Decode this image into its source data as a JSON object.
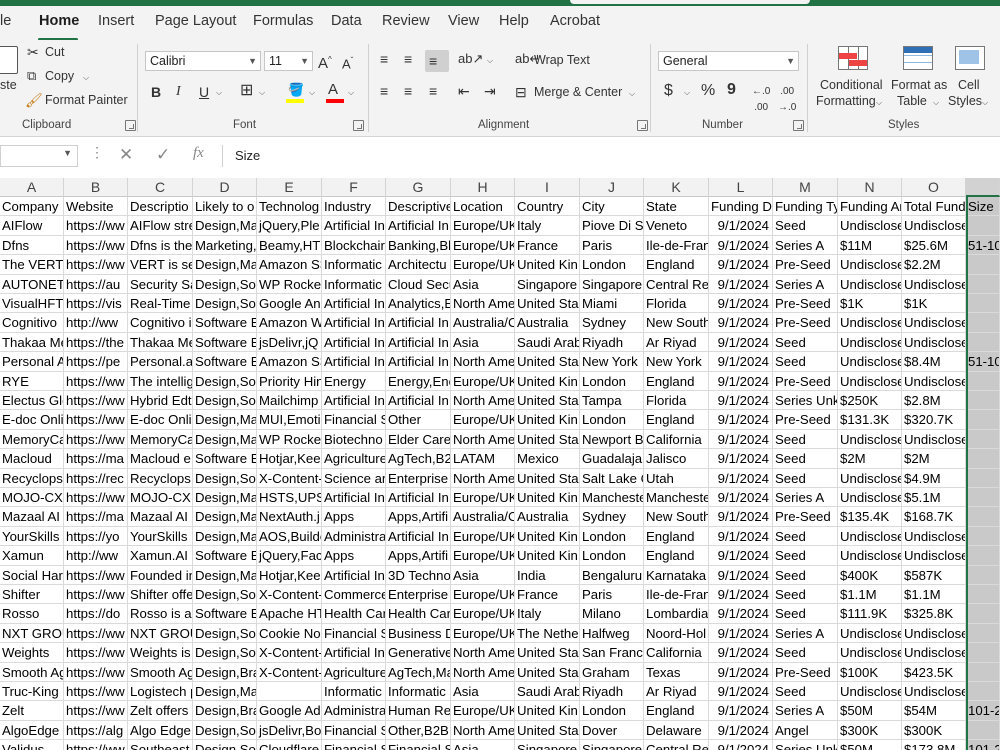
{
  "ribbon_tabs": [
    "le",
    "Home",
    "Insert",
    "Page Layout",
    "Formulas",
    "Data",
    "Review",
    "View",
    "Help",
    "Acrobat"
  ],
  "clipboard": {
    "paste": "ste",
    "cut": "Cut",
    "copy": "Copy",
    "format_painter": "Format Painter",
    "group": "Clipboard"
  },
  "font": {
    "name": "Calibri",
    "size": "11",
    "group": "Font"
  },
  "alignment": {
    "wrap_text": "Wrap Text",
    "merge_center": "Merge & Center",
    "group": "Alignment"
  },
  "number": {
    "format": "General",
    "group": "Number",
    "currency_symbol": "$",
    "percent_symbol": "%",
    "comma_symbol": "9"
  },
  "styles": {
    "conditional_formatting": [
      "Conditional",
      "Formatting"
    ],
    "format_as_table": [
      "Format as",
      "Table"
    ],
    "cell_styles": [
      "Cell",
      "Styles"
    ],
    "group": "Styles"
  },
  "formula_bar": {
    "fx": "fx",
    "value": "Size"
  },
  "columns": [
    "A",
    "B",
    "C",
    "D",
    "E",
    "F",
    "G",
    "H",
    "I",
    "J",
    "K",
    "L",
    "M",
    "N",
    "O"
  ],
  "selected_column_header": "",
  "rows": [
    [
      "Company",
      "Website",
      "Descriptio",
      "Likely to o",
      "Technolog",
      "Industry",
      "Descriptive",
      "Location",
      "Country",
      "City",
      "State",
      "Funding Da",
      "Funding Ty",
      "Funding Ar",
      "Total Fund",
      "Size"
    ],
    [
      "AIFlow",
      "https://ww",
      "AIFlow stre",
      "Design,Ma",
      "jQuery,Ple",
      "Artificial In",
      "Artificial In",
      "Europe/UK",
      "Italy",
      "Piove Di Sa",
      "Veneto",
      "9/1/2024",
      "Seed",
      "Undisclose",
      "Undisclose",
      ""
    ],
    [
      "Dfns",
      "https://ww",
      "Dfns is the",
      "Marketing,",
      "Beamy,HT",
      "Blockchair",
      "Banking,Bl",
      "Europe/UK",
      "France",
      "Paris",
      "Ile-de-Fran",
      "9/1/2024",
      "Series A",
      "$11M",
      "$25.6M",
      "51-10"
    ],
    [
      "The VERT",
      "https://ww",
      "VERT is set",
      "Design,Ma",
      "Amazon S3",
      "Informatic",
      "Architectu",
      "Europe/UK",
      "United Kin",
      "London",
      "England",
      "9/1/2024",
      "Pre-Seed",
      "Undisclose",
      "$2.2M",
      ""
    ],
    [
      "AUTONETI",
      "https://au",
      "Security Sa",
      "Design,Sof",
      "WP Rocket",
      "Informatic",
      "Cloud Secu",
      "Asia",
      "Singapore",
      "Singapore",
      "Central Re",
      "9/1/2024",
      "Series A",
      "Undisclose",
      "Undisclose",
      ""
    ],
    [
      "VisualHFT",
      "https://vis",
      "Real-Time",
      "Design,Sof",
      "Google An",
      "Artificial In",
      "Analytics,E",
      "North Ame",
      "United Sta",
      "Miami",
      "Florida",
      "9/1/2024",
      "Pre-Seed",
      "$1K",
      "$1K",
      ""
    ],
    [
      "Cognitivo",
      "http://ww",
      "Cognitivo i",
      "Software E",
      "Amazon W",
      "Artificial In",
      "Artificial In",
      "Australia/C",
      "Australia",
      "Sydney",
      "New South",
      "9/1/2024",
      "Pre-Seed",
      "Undisclose",
      "Undisclose",
      ""
    ],
    [
      "Thakaa Me",
      "https://the",
      "Thakaa Me",
      "Software E",
      "jsDelivr,jQ",
      "Artificial In",
      "Artificial In",
      "Asia",
      "Saudi Arab",
      "Riyadh",
      "Ar Riyad",
      "9/1/2024",
      "Seed",
      "Undisclose",
      "Undisclose",
      ""
    ],
    [
      "Personal A",
      "https://pe",
      "Personal.a",
      "Software E",
      "Amazon S3",
      "Artificial In",
      "Artificial In",
      "North Ame",
      "United Sta",
      "New York",
      "New York",
      "9/1/2024",
      "Seed",
      "Undisclose",
      "$8.4M",
      "51-10"
    ],
    [
      "RYE",
      "https://ww",
      "The intellig",
      "Design,Sof",
      "Priority Hin",
      "Energy",
      "Energy,Ene",
      "Europe/UK",
      "United Kin",
      "London",
      "England",
      "9/1/2024",
      "Pre-Seed",
      "Undisclose",
      "Undisclose",
      ""
    ],
    [
      "Electus Glo",
      "https://ww",
      "Hybrid Edt",
      "Design,Sof",
      "Mailchimp",
      "Artificial In",
      "Artificial In",
      "North Ame",
      "United Sta",
      "Tampa",
      "Florida",
      "9/1/2024",
      "Series Unk",
      "$250K",
      "$2.8M",
      ""
    ],
    [
      "E-doc Onli",
      "https://ww",
      "E-doc Onli",
      "Design,Ma",
      "MUI,Emoti",
      "Financial S",
      "Other",
      "Europe/UK",
      "United Kin",
      "London",
      "England",
      "9/1/2024",
      "Pre-Seed",
      "$131.3K",
      "$320.7K",
      ""
    ],
    [
      "MemoryCa",
      "https://ww",
      "MemoryCa",
      "Design,Ma",
      "WP Rocket",
      "Biotechno",
      "Elder Care",
      "North Ame",
      "United Sta",
      "Newport B",
      "California",
      "9/1/2024",
      "Seed",
      "Undisclose",
      "Undisclose",
      ""
    ],
    [
      "Macloud",
      "https://ma",
      "Macloud e",
      "Software E",
      "Hotjar,Kee",
      "Agriculture",
      "AgTech,B2",
      "LATAM",
      "Mexico",
      "Guadalajar",
      "Jalisco",
      "9/1/2024",
      "Seed",
      "$2M",
      "$2M",
      ""
    ],
    [
      "Recyclops",
      "https://rec",
      "Recyclops",
      "Design,Sof",
      "X-Content-",
      "Science an",
      "Enterprise",
      "North Ame",
      "United Sta",
      "Salt Lake C",
      "Utah",
      "9/1/2024",
      "Seed",
      "Undisclose",
      "$4.9M",
      ""
    ],
    [
      "MOJO-CX",
      "https://ww",
      "MOJO-CX i",
      "Design,Ma",
      "HSTS,UPS,I",
      "Artificial In",
      "Artificial In",
      "Europe/UK",
      "United Kin",
      "Mancheste",
      "Mancheste",
      "9/1/2024",
      "Series A",
      "Undisclose",
      "$5.1M",
      ""
    ],
    [
      "Mazaal AI",
      "https://ma",
      "Mazaal AI",
      "Design,Ma",
      "NextAuth.j",
      "Apps",
      "Apps,Artifi",
      "Australia/C",
      "Australia",
      "Sydney",
      "New South",
      "9/1/2024",
      "Pre-Seed",
      "$135.4K",
      "$168.7K",
      ""
    ],
    [
      "YourSkills",
      "https://yo",
      "YourSkills i",
      "Design,Ma",
      "AOS,Builde",
      "Administra",
      "Artificial In",
      "Europe/UK",
      "United Kin",
      "London",
      "England",
      "9/1/2024",
      "Seed",
      "Undisclose",
      "Undisclose",
      ""
    ],
    [
      "Xamun",
      "http://ww",
      "Xamun.AI",
      "Software E",
      "jQuery,Fac",
      "Apps",
      "Apps,Artifi",
      "Europe/UK",
      "United Kin",
      "London",
      "England",
      "9/1/2024",
      "Seed",
      "Undisclose",
      "Undisclose",
      ""
    ],
    [
      "Social Harc",
      "https://ww",
      "Founded in",
      "Design,Ma",
      "Hotjar,Kee",
      "Artificial In",
      "3D Techno",
      "Asia",
      "India",
      "Bengaluru",
      "Karnataka",
      "9/1/2024",
      "Seed",
      "$400K",
      "$587K",
      ""
    ],
    [
      "Shifter",
      "https://ww",
      "Shifter offe",
      "Design,Sof",
      "X-Content-",
      "Commerce",
      "Enterprise",
      "Europe/UK",
      "France",
      "Paris",
      "Ile-de-Fran",
      "9/1/2024",
      "Seed",
      "$1.1M",
      "$1.1M",
      ""
    ],
    [
      "Rosso",
      "https://do",
      "Rosso is a",
      "Software E",
      "Apache HT",
      "Health Car",
      "Health Car",
      "Europe/UK",
      "Italy",
      "Milano",
      "Lombardia",
      "9/1/2024",
      "Seed",
      "$111.9K",
      "$325.8K",
      ""
    ],
    [
      "NXT GROU",
      "https://ww",
      "NXT GROU",
      "Design,Sof",
      "Cookie No",
      "Financial S",
      "Business D",
      "Europe/UK",
      "The Nethe",
      "Halfweg",
      "Noord-Hol",
      "9/1/2024",
      "Series A",
      "Undisclose",
      "Undisclose",
      ""
    ],
    [
      "Weights",
      "https://ww",
      "Weights is",
      "Design,Sof",
      "X-Content-",
      "Artificial In",
      "Generative",
      "North Ame",
      "United Sta",
      "San Francis",
      "California",
      "9/1/2024",
      "Seed",
      "Undisclose",
      "Undisclose",
      ""
    ],
    [
      "Smooth Ag",
      "https://ww",
      "Smooth Ag",
      "Design,Bra",
      "X-Content-",
      "Agriculture",
      "AgTech,Ma",
      "North Ame",
      "United Sta",
      "Graham",
      "Texas",
      "9/1/2024",
      "Pre-Seed",
      "$100K",
      "$423.5K",
      ""
    ],
    [
      "Truc-King",
      "https://ww",
      "Logistech p",
      "Design,Marketing,Bra",
      "",
      "Informatic",
      "Informatic",
      "Asia",
      "Saudi Arab",
      "Riyadh",
      "Ar Riyad",
      "9/1/2024",
      "Seed",
      "Undisclose",
      "Undisclose",
      ""
    ],
    [
      "Zelt",
      "https://ww",
      "Zelt offers",
      "Design,Bra",
      "Google Ad",
      "Administra",
      "Human Re",
      "Europe/UK",
      "United Kin",
      "London",
      "England",
      "9/1/2024",
      "Series A",
      "$50M",
      "$54M",
      "101-2"
    ],
    [
      "AlgoEdge",
      "https://alg",
      "Algo Edge:",
      "Design,Sof",
      "jsDelivr,Bo",
      "Financial S",
      "Other,B2B",
      "North Ame",
      "United Sta",
      "Dover",
      "Delaware",
      "9/1/2024",
      "Angel",
      "$300K",
      "$300K",
      ""
    ],
    [
      "Validus",
      "https://ww",
      "Southeast",
      "Design,Sof",
      "Cloudflare",
      "Financial S",
      "Financial S",
      "Asia",
      "Singapore",
      "Singapore",
      "Central Re",
      "9/1/2024",
      "Series Unk",
      "$50M",
      "$173.8M",
      "101-2"
    ]
  ]
}
